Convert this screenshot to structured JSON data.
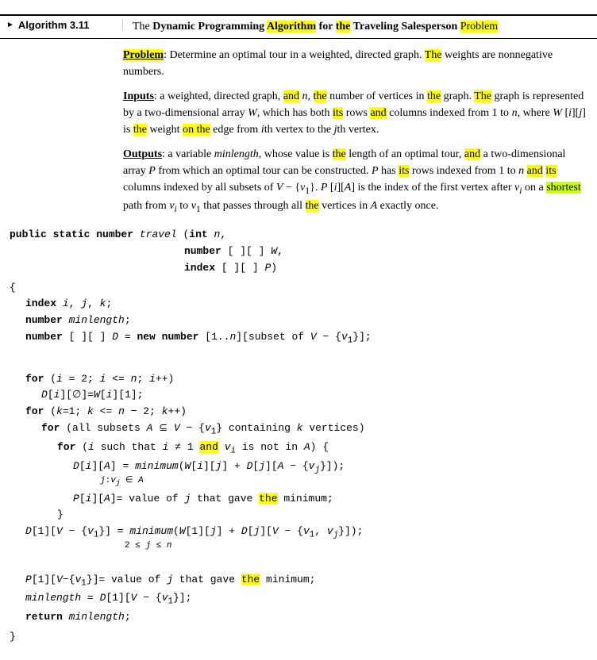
{
  "algorithm": {
    "label": "Algorithm 3.11",
    "title_prefix": "The ",
    "title_dp": "Dynamic Programming Algorithm for the Traveling Salesperson ",
    "title_suffix": "Problem",
    "problem_label": "Problem",
    "problem_text": ": Determine an optimal tour in a weighted, directed graph. The weights are nonnegative numbers.",
    "inputs_label": "Inputs",
    "inputs_text": ": a weighted, directed graph, and ",
    "inputs_n": "n",
    "inputs_rest": ", the number of vertices in the graph. The graph is represented by a two-dimensional array ",
    "inputs_W": "W",
    "inputs_rest2": ", which has both its rows and columns indexed from 1 to ",
    "inputs_n2": "n",
    "inputs_rest3": ", where ",
    "inputs_W2": "W",
    "inputs_rest4": " [",
    "inputs_i": "i",
    "inputs_rest5": "][",
    "inputs_j": "j",
    "inputs_rest6": "] is the weight on the edge from ",
    "inputs_ith": "i",
    "inputs_rest7": "th vertex to the ",
    "inputs_jth": "j",
    "inputs_rest8": "th vertex.",
    "outputs_label": "Outputs",
    "outputs_text": ": a variable ",
    "outputs_ml": "minlength",
    "outputs_rest": ", whose value is the length of an optimal tour, and a two-dimensional array ",
    "outputs_P": "P",
    "outputs_rest2": " from which an optimal tour can be constructed. ",
    "outputs_P2": "P",
    "outputs_rest3": " has its rows indexed from 1 to ",
    "outputs_n": "n",
    "outputs_rest4": " and its columns indexed by all subsets of ",
    "outputs_rest5": "V",
    "outputs_rest6": " − {v",
    "outputs_sub1": "1",
    "outputs_rest7": "}. ",
    "outputs_P3": "P",
    "outputs_rest8": "[",
    "outputs_i": "i",
    "outputs_rest9": "][",
    "outputs_A": "A",
    "outputs_rest10": "] is the index of the first vertex after ",
    "outputs_vi": "v",
    "outputs_sub2": "i",
    "outputs_rest11": " on a shortest path from ",
    "outputs_vi2": "v",
    "outputs_sub3": "i",
    "outputs_rest12": " to ",
    "outputs_v1": "v",
    "outputs_sub4": "1",
    "outputs_rest13": " that passes through all the vertices in ",
    "outputs_A2": "A",
    "outputs_rest14": " exactly once.",
    "code_title": "public static number travel"
  }
}
